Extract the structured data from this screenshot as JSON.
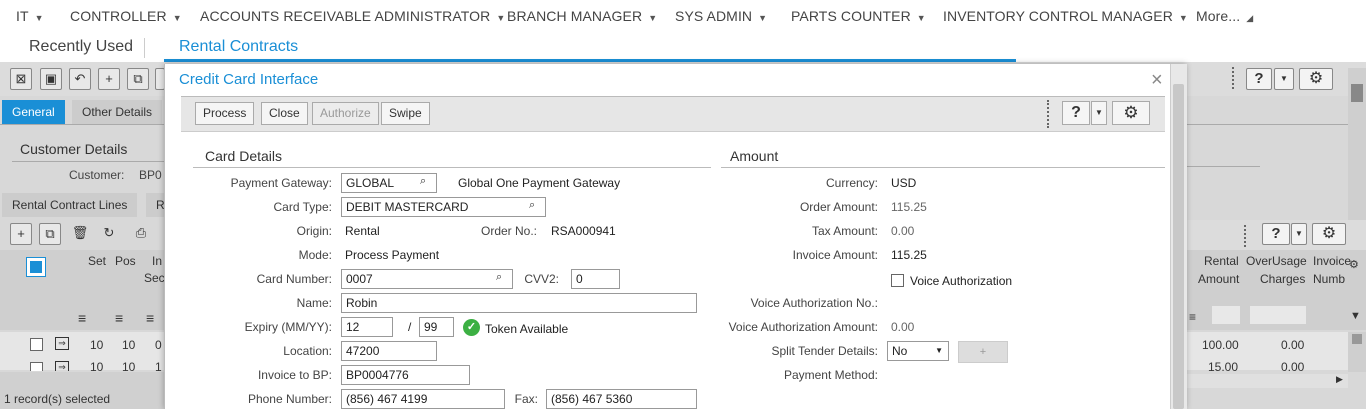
{
  "top_menu": [
    "IT",
    "CONTROLLER",
    "ACCOUNTS RECEIVABLE ADMINISTRATOR",
    "BRANCH MANAGER",
    "SYS ADMIN",
    "PARTS COUNTER",
    "INVENTORY CONTROL MANAGER",
    "More..."
  ],
  "secondary_tabs": {
    "recently_used": "Recently Used",
    "rental_contracts": "Rental Contracts"
  },
  "background": {
    "tabs": [
      "General",
      "Other Details"
    ],
    "section_title": "Customer Details",
    "customer_label": "Customer:",
    "customer_value": "BP0",
    "line_tabs": [
      "Rental Contract Lines",
      "R"
    ],
    "col_set": "Set",
    "col_pos": "Pos",
    "col_inv_1": "In",
    "col_inv_2": "Sec",
    "right_cols": {
      "rental_1": "Rental",
      "rental_2": "Amount",
      "overusage_1": "OverUsage",
      "overusage_2": "Charges",
      "invoice_1": "Invoice",
      "invoice_2": "Numb"
    },
    "rows": [
      {
        "set": "10",
        "pos": "10",
        "inv": "0",
        "rental": "100.00",
        "overusage": "0.00"
      },
      {
        "set": "10",
        "pos": "10",
        "inv": "1",
        "rental": "15.00",
        "overusage": "0.00"
      }
    ],
    "status": "1 record(s) selected"
  },
  "modal": {
    "title": "Credit Card Interface",
    "buttons": {
      "process": "Process",
      "close": "Close",
      "authorize": "Authorize",
      "swipe": "Swipe"
    },
    "card_details": {
      "title": "Card Details",
      "payment_gateway_label": "Payment Gateway:",
      "payment_gateway_value": "GLOBAL",
      "payment_gateway_desc": "Global One Payment Gateway",
      "card_type_label": "Card Type:",
      "card_type_value": "DEBIT MASTERCARD",
      "origin_label": "Origin:",
      "origin_value": "Rental",
      "order_no_label": "Order No.:",
      "order_no_value": "RSA000941",
      "mode_label": "Mode:",
      "mode_value": "Process Payment",
      "card_number_label": "Card Number:",
      "card_number_value": "0007",
      "cvv2_label": "CVV2:",
      "cvv2_value": "0",
      "name_label": "Name:",
      "name_value": "Robin",
      "expiry_label": "Expiry (MM/YY):",
      "expiry_month": "12",
      "expiry_sep": "/",
      "expiry_year": "99",
      "token_label": "Token Available",
      "location_label": "Location:",
      "location_value": "47200",
      "invoice_bp_label": "Invoice to BP:",
      "invoice_bp_value": "BP0004776",
      "phone_label": "Phone Number:",
      "phone_value": "(856) 467 4199",
      "fax_label": "Fax:",
      "fax_value": "(856) 467 5360"
    },
    "amount": {
      "title": "Amount",
      "currency_label": "Currency:",
      "currency_value": "USD",
      "order_amount_label": "Order Amount:",
      "order_amount_value": "115.25",
      "tax_amount_label": "Tax Amount:",
      "tax_amount_value": "0.00",
      "invoice_amount_label": "Invoice Amount:",
      "invoice_amount_value": "115.25",
      "voice_auth_label": "Voice Authorization",
      "voice_auth_no_label": "Voice Authorization No.:",
      "voice_auth_amount_label": "Voice Authorization Amount:",
      "voice_auth_amount_value": "0.00",
      "split_tender_label": "Split Tender Details:",
      "split_tender_value": "No",
      "split_plus": "+",
      "payment_method_label": "Payment Method:"
    }
  },
  "colors": {
    "accent": "#1a8fd6",
    "token_green": "#3cb043"
  }
}
